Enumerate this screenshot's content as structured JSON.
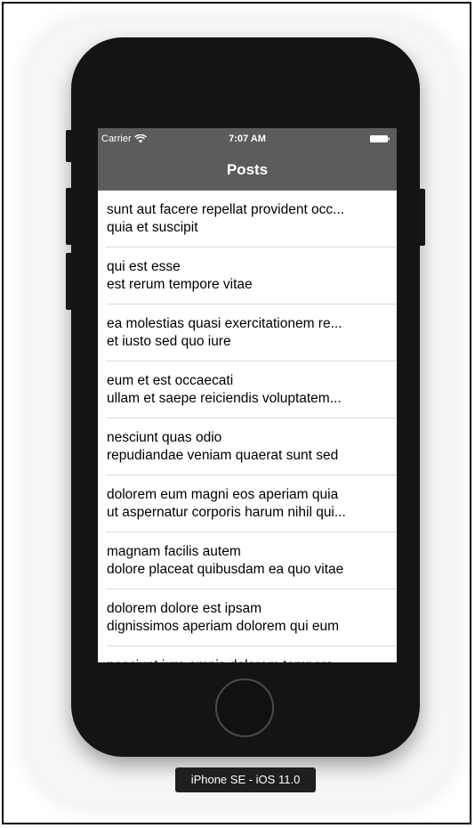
{
  "device_label": "iPhone SE - iOS 11.0",
  "status_bar": {
    "carrier": "Carrier",
    "time": "7:07 AM"
  },
  "nav": {
    "title": "Posts"
  },
  "colors": {
    "nav_bar": "#5c5c5c",
    "phone_body": "#141414",
    "separator": "#d9d9d9"
  },
  "posts": [
    {
      "title": "sunt aut facere repellat provident occ...",
      "body": "quia et suscipit"
    },
    {
      "title": "qui est esse",
      "body": "est rerum tempore vitae"
    },
    {
      "title": "ea molestias quasi exercitationem re...",
      "body": "et iusto sed quo iure"
    },
    {
      "title": "eum et est occaecati",
      "body": "ullam et saepe reiciendis voluptatem..."
    },
    {
      "title": "nesciunt quas odio",
      "body": "repudiandae veniam quaerat sunt sed"
    },
    {
      "title": "dolorem eum magni eos aperiam quia",
      "body": "ut aspernatur corporis harum nihil qui..."
    },
    {
      "title": "magnam facilis autem",
      "body": "dolore placeat quibusdam ea quo vitae"
    },
    {
      "title": "dolorem dolore est ipsam",
      "body": "dignissimos aperiam dolorem qui eum"
    },
    {
      "title": "nesciunt iure omnis dolorem tempora",
      "body": ""
    }
  ]
}
